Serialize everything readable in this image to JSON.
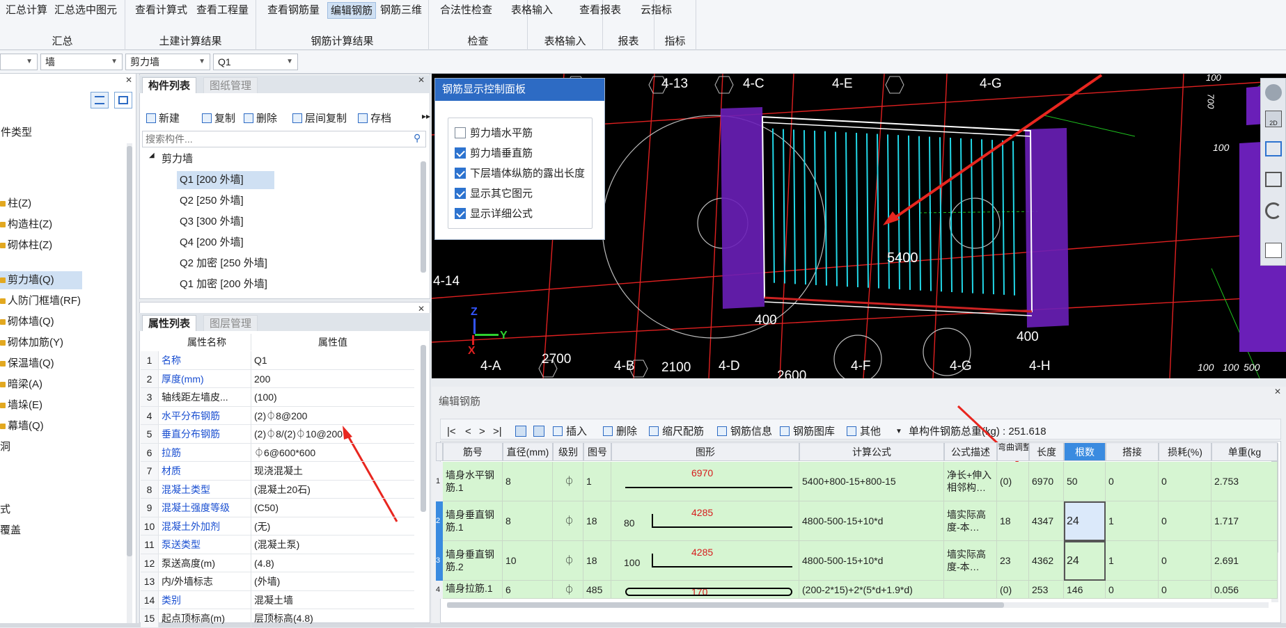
{
  "ribbon": {
    "groups": [
      {
        "label": "汇总",
        "buttons": [
          "汇总计算",
          "汇总选中图元"
        ]
      },
      {
        "label": "土建计算结果",
        "buttons": [
          "查看计算式",
          "查看工程量"
        ]
      },
      {
        "label": "钢筋计算结果",
        "buttons": [
          "查看钢筋量",
          "编辑钢筋",
          "钢筋三维"
        ]
      },
      {
        "label": "检查",
        "buttons": [
          "合法性检查"
        ]
      },
      {
        "label": "表格输入",
        "buttons": [
          "表格输入"
        ]
      },
      {
        "label": "报表",
        "buttons": [
          "查看报表"
        ]
      },
      {
        "label": "指标",
        "buttons": [
          "云指标"
        ]
      }
    ],
    "active_button": "编辑钢筋"
  },
  "selectors": [
    "",
    "墙",
    "剪力墙",
    "Q1"
  ],
  "left_panel": {
    "items": [
      "构件类型",
      "柱(Z)",
      "构造柱(Z)",
      "砌体柱(Z)",
      "剪力墙(Q)",
      "人防门框墙(RF)",
      "砌体墙(Q)",
      "砌体加筋(Y)",
      "保温墙(Q)",
      "暗梁(A)",
      "墙垛(E)",
      "幕墙(Q)",
      "洞",
      "式",
      "覆盖"
    ],
    "selected": "剪力墙(Q)"
  },
  "component_panel": {
    "tabs": [
      "构件列表",
      "图纸管理"
    ],
    "toolbar": [
      "新建",
      "复制",
      "删除",
      "层间复制",
      "存档"
    ],
    "search_placeholder": "搜索构件...",
    "tree_root": "剪力墙",
    "items": [
      "Q1 [200 外墙]",
      "Q2 [250 外墙]",
      "Q3 [300 外墙]",
      "Q4 [200 外墙]",
      "Q2 加密 [250 外墙]",
      "Q1 加密 [200 外墙]"
    ],
    "selected": "Q1 [200 外墙]"
  },
  "property_panel": {
    "tabs": [
      "属性列表",
      "图层管理"
    ],
    "headers": [
      "属性名称",
      "属性值"
    ],
    "rows": [
      {
        "n": "1",
        "name": "名称",
        "value": "Q1",
        "blue": true
      },
      {
        "n": "2",
        "name": "厚度(mm)",
        "value": "200",
        "blue": true
      },
      {
        "n": "3",
        "name": "轴线距左墙皮...",
        "value": "(100)",
        "blue": false
      },
      {
        "n": "4",
        "name": "水平分布钢筋",
        "value": "(2)⏀8@200",
        "blue": true
      },
      {
        "n": "5",
        "name": "垂直分布钢筋",
        "value": "(2)⏀8/(2)⏀10@200",
        "blue": true
      },
      {
        "n": "6",
        "name": "拉筋",
        "value": "⏀6@600*600",
        "blue": true
      },
      {
        "n": "7",
        "name": "材质",
        "value": "现浇混凝土",
        "blue": true
      },
      {
        "n": "8",
        "name": "混凝土类型",
        "value": "(混凝土20石)",
        "blue": true
      },
      {
        "n": "9",
        "name": "混凝土强度等级",
        "value": "(C50)",
        "blue": true
      },
      {
        "n": "10",
        "name": "混凝土外加剂",
        "value": "(无)",
        "blue": true
      },
      {
        "n": "11",
        "name": "泵送类型",
        "value": "(混凝土泵)",
        "blue": true
      },
      {
        "n": "12",
        "name": "泵送高度(m)",
        "value": "(4.8)",
        "blue": false
      },
      {
        "n": "13",
        "name": "内/外墙标志",
        "value": "(外墙)",
        "blue": false
      },
      {
        "n": "14",
        "name": "类别",
        "value": "混凝土墙",
        "blue": true
      },
      {
        "n": "15",
        "name": "起点顶标高(m)",
        "value": "层顶标高(4.8)",
        "blue": false
      }
    ]
  },
  "control_panel": {
    "title": "钢筋显示控制面板",
    "options": [
      {
        "label": "剪力墙水平筋",
        "checked": false
      },
      {
        "label": "剪力墙垂直筋",
        "checked": true
      },
      {
        "label": "下层墙体纵筋的露出长度",
        "checked": true
      },
      {
        "label": "显示其它图元",
        "checked": true
      },
      {
        "label": "显示详细公式",
        "checked": true
      }
    ]
  },
  "viewport": {
    "axis_labels": [
      "4-13",
      "4-C",
      "4-E",
      "4-G",
      "4-14",
      "4-A",
      "4-B",
      "4-D",
      "4-F",
      "4-G",
      "4-H"
    ],
    "dims": [
      "5400",
      "400",
      "400",
      "2700",
      "2100",
      "2600",
      "100",
      "700",
      "100",
      "100",
      "100",
      "500"
    ],
    "axes": [
      "Z",
      "Y",
      "X"
    ],
    "view_mode": "2D"
  },
  "edit_panel": {
    "title": "编辑钢筋",
    "toolbar": [
      "插入",
      "删除",
      "缩尺配筋",
      "钢筋信息",
      "钢筋图库",
      "其他"
    ],
    "nav": [
      "|<",
      "<",
      ">",
      ">|"
    ],
    "total_weight_label": "单构件钢筋总重(kg) : 251.618",
    "headers": [
      "筋号",
      "直径(mm)",
      "级别",
      "图号",
      "图形",
      "计算公式",
      "公式描述",
      "弯曲调整",
      "长度",
      "根数",
      "搭接",
      "损耗(%)",
      "单重(kg"
    ],
    "rows": [
      {
        "idx": "1",
        "name": "墙身水平钢筋.1",
        "dia": "8",
        "grade": "⏀",
        "fig": "1",
        "shape_left": "",
        "shape_val": "6970",
        "formula": "5400+800-15+800-15",
        "desc": "净长+伸入相邻构…",
        "bend": "(0)",
        "len": "6970",
        "count": "50",
        "lap": "0",
        "loss": "0",
        "unit": "2.753"
      },
      {
        "idx": "2",
        "name": "墙身垂直钢筋.1",
        "dia": "8",
        "grade": "⏀",
        "fig": "18",
        "shape_left": "80",
        "shape_val": "4285",
        "formula": "4800-500-15+10*d",
        "desc": "墙实际高度-本…",
        "bend": "18",
        "len": "4347",
        "count": "24",
        "lap": "1",
        "loss": "0",
        "unit": "1.717"
      },
      {
        "idx": "3",
        "name": "墙身垂直钢筋.2",
        "dia": "10",
        "grade": "⏀",
        "fig": "18",
        "shape_left": "100",
        "shape_val": "4285",
        "formula": "4800-500-15+10*d",
        "desc": "墙实际高度-本…",
        "bend": "23",
        "len": "4362",
        "count": "24",
        "lap": "1",
        "loss": "0",
        "unit": "2.691"
      },
      {
        "idx": "4",
        "name": "墙身拉筋.1",
        "dia": "6",
        "grade": "⏀",
        "fig": "485",
        "shape_left": "",
        "shape_val": "170",
        "formula": "(200-2*15)+2*(5*d+1.9*d)",
        "desc": "",
        "bend": "(0)",
        "len": "253",
        "count": "146",
        "lap": "0",
        "loss": "0",
        "unit": "0.056"
      }
    ]
  },
  "colors": {
    "accent": "#2d6bc4",
    "grid_green": "#d6f5d2",
    "rebar_cyan": "#22d8e8",
    "wall_purple": "#6a1fb8",
    "arrow_red": "#e8261f"
  }
}
